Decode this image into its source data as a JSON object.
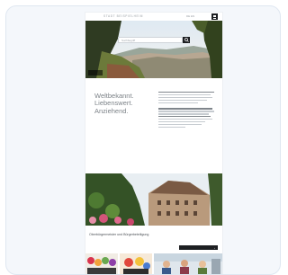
{
  "header": {
    "brand": "STADT BEISPIELHEIM",
    "language": "DE EN",
    "menu_icon": "hamburger-menu-icon"
  },
  "hero": {
    "search_placeholder": "Suchbegriff",
    "search_icon": "search-icon"
  },
  "intro": {
    "tagline_lines": [
      "Weltbekannt.",
      "Liebenswert.",
      "Anziehend."
    ]
  },
  "section": {
    "title": "Oberbürgermeister und Bürgerbeteiligung"
  },
  "colors": {
    "dark": "#1d1f22",
    "tagline": "#7d8388",
    "card_bg": "#f4f7fb"
  }
}
